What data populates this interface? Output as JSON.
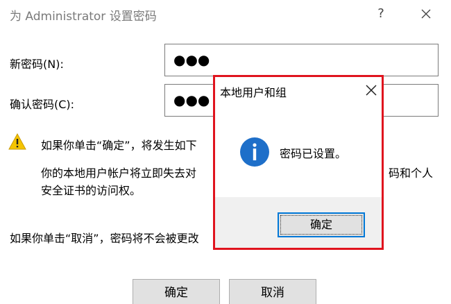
{
  "window": {
    "title": "为 Administrator 设置密码",
    "help_symbol": "?"
  },
  "form": {
    "new_password_label": "新密码(N):",
    "new_password_value": "●●●",
    "confirm_password_label": "确认密码(C):",
    "confirm_password_value": "●●●"
  },
  "warning": {
    "line1": "如果你单击“确定”，将发生如下",
    "line2_left": "你的本地用户帐户将立即失去对",
    "line2_right": "码和个人",
    "line3": "安全证书的访问权。",
    "cancel_note": "如果你单击“取消”，密码将不会被更改"
  },
  "buttons": {
    "ok": "确定",
    "cancel": "取消"
  },
  "message_box": {
    "title": "本地用户和组",
    "message": "密码已设置。",
    "ok": "确定",
    "highlight_color": "#e0141e",
    "icon": "info-icon"
  }
}
